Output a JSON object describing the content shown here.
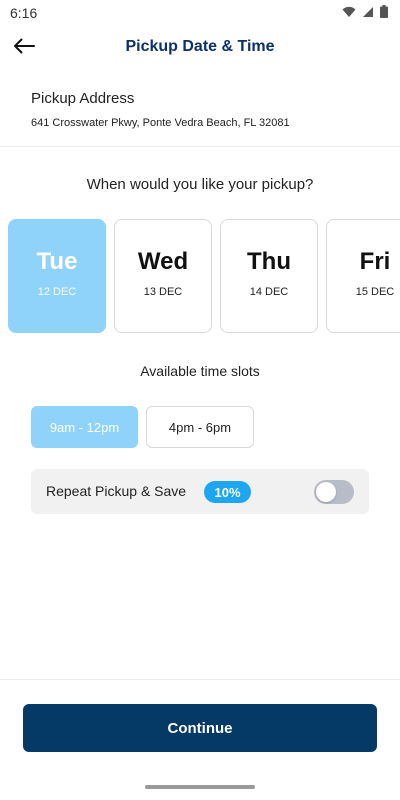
{
  "status_bar": {
    "time": "6:16"
  },
  "app_bar": {
    "title": "Pickup Date & Time",
    "back_icon": "arrow-left-icon"
  },
  "address": {
    "label": "Pickup Address",
    "value": "641 Crosswater Pkwy, Ponte Vedra Beach, FL 32081"
  },
  "question": "When would you like your pickup?",
  "days": [
    {
      "name": "Tue",
      "date": "12 DEC",
      "selected": true
    },
    {
      "name": "Wed",
      "date": "13 DEC",
      "selected": false
    },
    {
      "name": "Thu",
      "date": "14 DEC",
      "selected": false
    },
    {
      "name": "Fri",
      "date": "15 DEC",
      "selected": false
    }
  ],
  "slots": {
    "title": "Available time slots",
    "items": [
      {
        "label": "9am - 12pm",
        "selected": true
      },
      {
        "label": "4pm - 6pm",
        "selected": false
      }
    ]
  },
  "repeat": {
    "label": "Repeat Pickup & Save",
    "discount": "10%",
    "enabled": false
  },
  "continue_label": "Continue",
  "colors": {
    "title": "#0d2f6a",
    "selected": "#8fd3fb",
    "badge": "#1ea7f0",
    "button": "#063a66"
  }
}
